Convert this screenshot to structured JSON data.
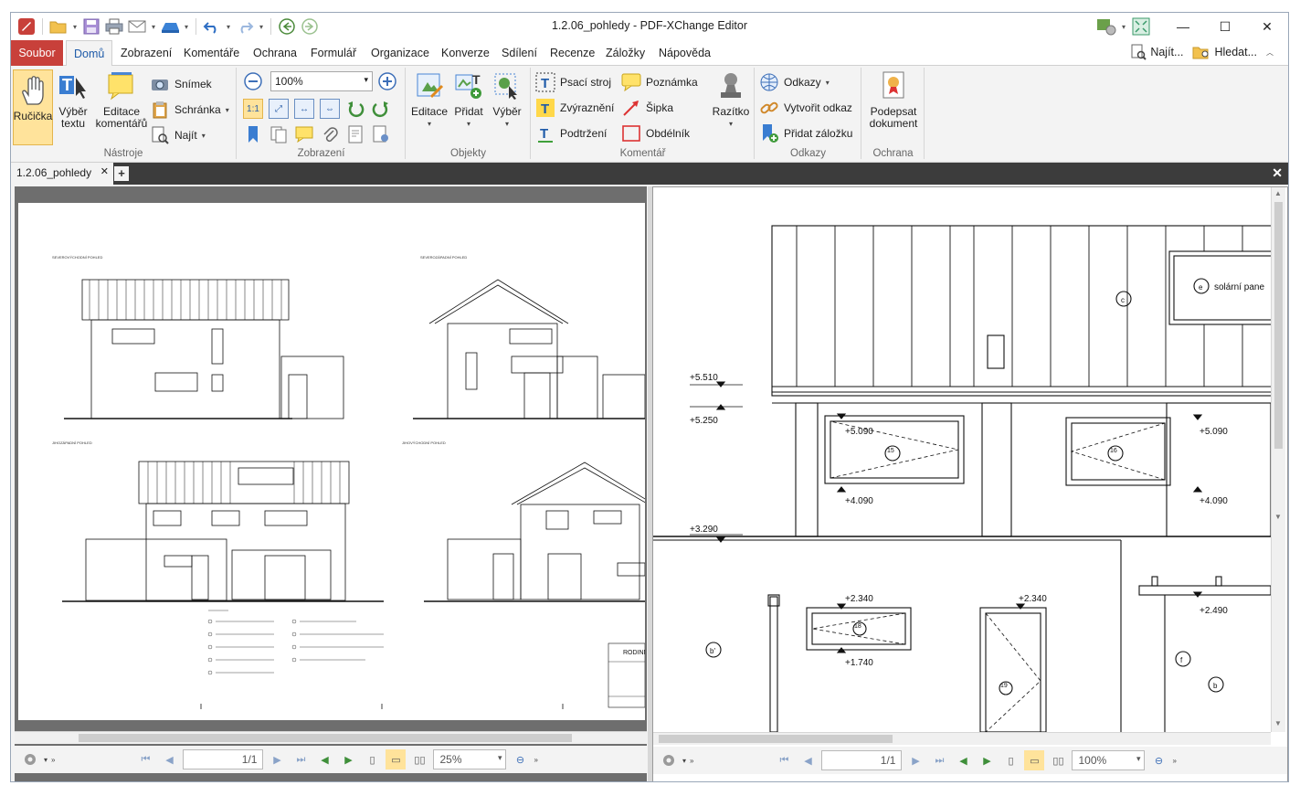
{
  "window": {
    "title": "1.2.06_pohledy - PDF-XChange Editor"
  },
  "menu": {
    "tabs": [
      "Soubor",
      "Domů",
      "Zobrazení",
      "Komentáře",
      "Ochrana",
      "Formulář",
      "Organizace",
      "Konverze",
      "Sdílení",
      "Recenze",
      "Záložky",
      "Nápověda"
    ],
    "find_label": "Najít...",
    "search_label": "Hledat..."
  },
  "ribbon": {
    "tools": {
      "hand": "Ručička",
      "select_text_1": "Výběr",
      "select_text_2": "textu",
      "edit_comments_1": "Editace",
      "edit_comments_2": "komentářů",
      "snapshot": "Snímek",
      "clipboard": "Schránka",
      "find": "Najít",
      "group_label": "Nástroje"
    },
    "view": {
      "zoom_value": "100%",
      "actual_size": "1:1",
      "group_label": "Zobrazení"
    },
    "objects": {
      "edit": "Editace",
      "add": "Přidat",
      "select": "Výběr",
      "group_label": "Objekty"
    },
    "comment": {
      "typewriter": "Psací stroj",
      "highlight": "Zvýraznění",
      "underline": "Podtržení",
      "note": "Poznámka",
      "arrow": "Šipka",
      "rectangle": "Obdélník",
      "stamp": "Razítko",
      "group_label": "Komentář"
    },
    "links": {
      "links": "Odkazy",
      "create_link": "Vytvořit odkaz",
      "add_bookmark": "Přidat záložku",
      "group_label": "Odkazy"
    },
    "protect": {
      "sign_1": "Podepsat",
      "sign_2": "dokument",
      "group_label": "Ochrana"
    }
  },
  "doc_tab": {
    "name": "1.2.06_pohledy"
  },
  "left_pane": {
    "views": [
      "SEVEROVÝCHODNÍ POHLED",
      "SEVEROZÁPADNÍ POHLED",
      "JIHOZÁPADNÍ POHLED",
      "JIHOVÝCHODNÍ POHLED"
    ],
    "titleblock_text": "RODINNÝ",
    "page_box": "1/1",
    "zoom": "25%"
  },
  "right_pane": {
    "elevations": [
      "+5.510",
      "+5.250",
      "+5.090",
      "+4.090",
      "+3.290",
      "+2.340",
      "+1.740",
      "+2.340",
      "+5.090",
      "+4.090",
      "+2.490"
    ],
    "solar_label": "solární pane",
    "markers": [
      "c",
      "e",
      "b'",
      "f",
      "b"
    ],
    "window_tags": [
      "15",
      "16",
      "18",
      "19"
    ],
    "page_box": "1/1",
    "zoom": "100%"
  },
  "colors": {
    "file_tab": "#c8403a",
    "accent": "#1e5aa8",
    "active_tool": "#ffe39b"
  }
}
